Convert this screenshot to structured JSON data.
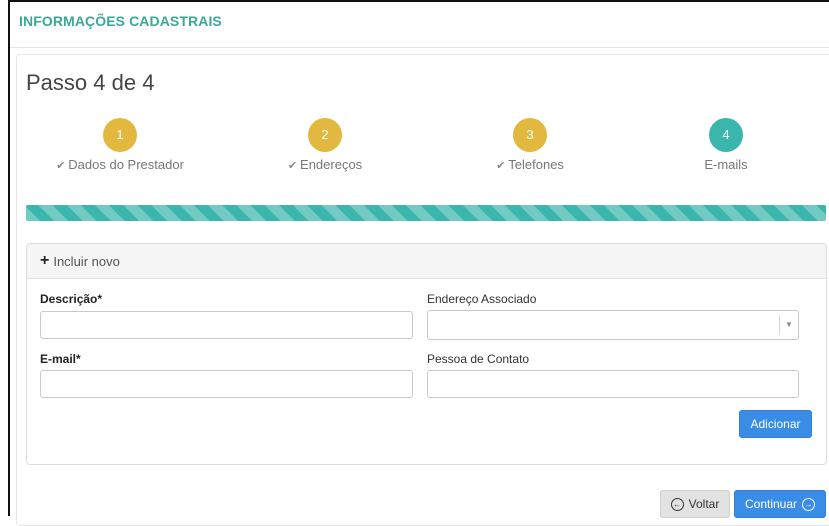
{
  "header": {
    "title": "INFORMAÇÕES CADASTRAIS"
  },
  "wizard": {
    "heading": "Passo 4 de 4",
    "progress_fraction": 1.0,
    "steps": [
      {
        "number": "1",
        "label": "Dados do Prestador",
        "state": "done"
      },
      {
        "number": "2",
        "label": "Endereços",
        "state": "done"
      },
      {
        "number": "3",
        "label": "Telefones",
        "state": "done"
      },
      {
        "number": "4",
        "label": "E-mails",
        "state": "active"
      }
    ]
  },
  "form": {
    "panel_title": "Incluir novo",
    "descricao_label": "Descrição*",
    "descricao_value": "",
    "endereco_label": "Endereço Associado",
    "endereco_selected": "",
    "email_label": "E-mail*",
    "email_value": "",
    "contato_label": "Pessoa de Contato",
    "contato_value": "",
    "add_button": "Adicionar"
  },
  "footer": {
    "back_label": "Voltar",
    "continue_label": "Continuar"
  },
  "icons": {
    "check": "check-icon",
    "plus": "plus-icon",
    "caret": "caret-down-icon",
    "back": "circle-arrow-left-icon",
    "forward": "circle-arrow-right-icon"
  },
  "colors": {
    "accent_teal": "#3bb6ac",
    "step_done": "#e3b83e",
    "header_text": "#3aa79b",
    "primary_button": "#3a8de6",
    "secondary_button": "#e2e2e2"
  }
}
